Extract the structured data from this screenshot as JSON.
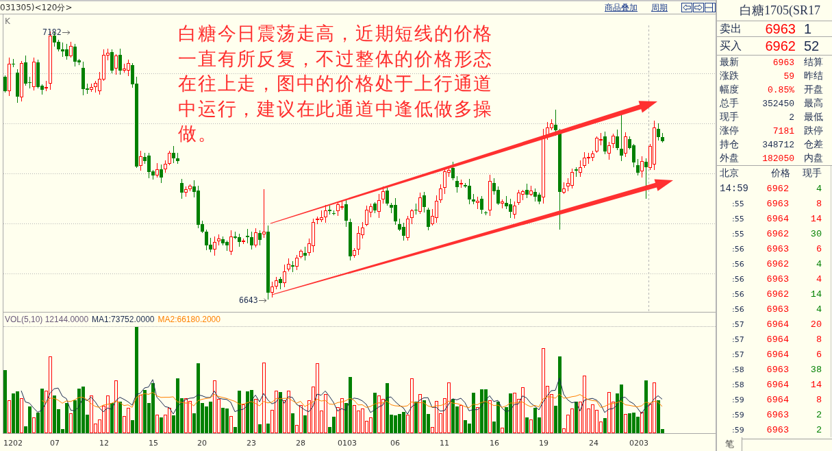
{
  "toolbar": {
    "title": "031305)<120分>",
    "links": [
      "商品叠加",
      "周期"
    ]
  },
  "chart": {
    "indicator": "K",
    "high": "7182",
    "low": "6643",
    "annotation": "白糖今日震荡走高，近期短线的价格一直有所反复，不过整体的价格形态在往上走，图中的价格处于上行通道中运行，建议在此通道中逢低做多操做。"
  },
  "volume": {
    "legend": [
      {
        "kind": "vol",
        "text": "VOL(5,10) 12144.0000"
      },
      {
        "kind": "ma1",
        "text": "MA1:73752.0000"
      },
      {
        "kind": "ma2",
        "text": "MA2:66180.2000"
      }
    ]
  },
  "x_axis": {
    "labels": [
      "1202",
      "07",
      "12",
      "15",
      "20",
      "23",
      "28",
      "0103",
      "06",
      "11",
      "16",
      "19",
      "24",
      "0203"
    ]
  },
  "quote": {
    "title": "白糖1705(SR17",
    "ask": {
      "label": "卖出",
      "price": "6963",
      "volume": "1"
    },
    "bid": {
      "label": "买入",
      "price": "6962",
      "volume": "52"
    },
    "stats": [
      {
        "label": "最新",
        "value": "6963",
        "color": "#ff0000",
        "label_2": "结算"
      },
      {
        "label": "涨跌",
        "value": "59",
        "color": "#ff0000",
        "label_2": "昨结"
      },
      {
        "label": "幅度",
        "value": "0.85%",
        "color": "#ff0000",
        "label_2": "开盘"
      },
      {
        "label": "总手",
        "value": "352450",
        "color": "#1c2b4f",
        "label_2": "最高"
      },
      {
        "label": "现手",
        "value": "2",
        "color": "#1c2b4f",
        "label_2": "最低"
      },
      {
        "label": "涨停",
        "value": "7181",
        "color": "#ff0000",
        "label_2": "跌停"
      },
      {
        "label": "持仓",
        "value": "348712",
        "color": "#1c2b4f",
        "label_2": "仓差"
      },
      {
        "label": "外盘",
        "value": "182050",
        "color": "#ff0000",
        "label_2": "内盘"
      }
    ]
  },
  "trades": {
    "columns": [
      "北京",
      "价格",
      "现手"
    ],
    "rows": [
      {
        "time": "14:59",
        "kind": "full",
        "price": "6962",
        "volume": "4",
        "color": "#008000"
      },
      {
        "time": ":55",
        "kind": "short",
        "price": "6963",
        "volume": "8",
        "color": "#ff0000"
      },
      {
        "time": ":55",
        "kind": "short",
        "price": "6964",
        "volume": "14",
        "color": "#ff0000"
      },
      {
        "time": ":55",
        "kind": "short",
        "price": "6962",
        "volume": "30",
        "color": "#008000"
      },
      {
        "time": ":56",
        "kind": "short",
        "price": "6963",
        "volume": "6",
        "color": "#ff0000"
      },
      {
        "time": ":56",
        "kind": "short",
        "price": "6962",
        "volume": "4",
        "color": "#008000"
      },
      {
        "time": ":56",
        "kind": "short",
        "price": "6963",
        "volume": "4",
        "color": "#ff0000"
      },
      {
        "time": ":56",
        "kind": "short",
        "price": "6962",
        "volume": "14",
        "color": "#008000"
      },
      {
        "time": ":56",
        "kind": "short",
        "price": "6963",
        "volume": "4",
        "color": "#008000"
      },
      {
        "time": ":57",
        "kind": "short",
        "price": "6964",
        "volume": "20",
        "color": "#ff0000"
      },
      {
        "time": ":57",
        "kind": "short",
        "price": "6964",
        "volume": "8",
        "color": "#ff0000"
      },
      {
        "time": ":57",
        "kind": "short",
        "price": "6964",
        "volume": "6",
        "color": "#ff0000"
      },
      {
        "time": ":58",
        "kind": "short",
        "price": "6963",
        "volume": "38",
        "color": "#008000"
      },
      {
        "time": ":58",
        "kind": "short",
        "price": "6964",
        "volume": "14",
        "color": "#ff0000"
      },
      {
        "time": ":59",
        "kind": "short",
        "price": "6964",
        "volume": "8",
        "color": "#ff0000"
      },
      {
        "time": ":59",
        "kind": "short",
        "price": "6963",
        "volume": "2",
        "color": "#008000"
      },
      {
        "time": ":59",
        "kind": "short",
        "price": "6963",
        "volume": "2",
        "color": "#008000"
      }
    ]
  },
  "tabs": [
    {
      "label": "笔"
    }
  ]
}
